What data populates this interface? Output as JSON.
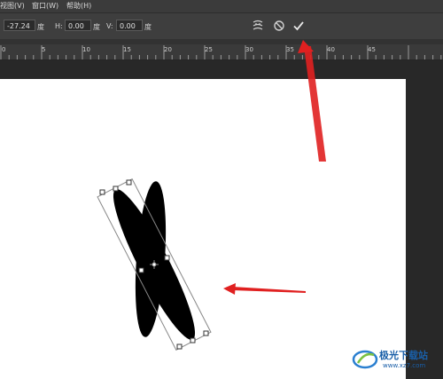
{
  "menu": {
    "view": "视图(V)",
    "window": "窗口(W)",
    "help": "帮助(H)"
  },
  "options": {
    "angle_value": "-27.24",
    "angle_unit": "度",
    "h_label": "H:",
    "h_value": "0.00",
    "h_unit": "度",
    "v_label": "V:",
    "v_value": "0.00",
    "v_unit": "度"
  },
  "ruler": {
    "ticks": [
      "0",
      "5",
      "10",
      "15",
      "20",
      "25",
      "30",
      "35",
      "40",
      "45"
    ]
  },
  "watermark": {
    "name": "极光下载站",
    "url": "www.xz7.com"
  },
  "colors": {
    "arrow": "#e02020",
    "canvas": "#ffffff",
    "shape": "#000000"
  }
}
